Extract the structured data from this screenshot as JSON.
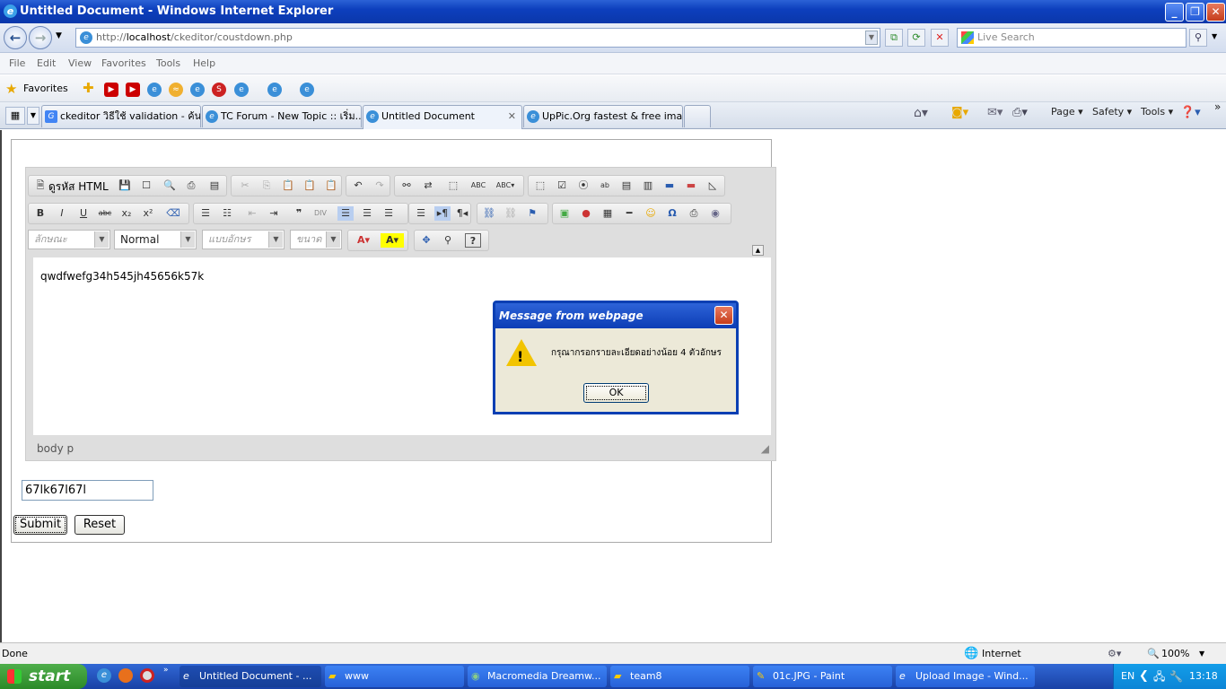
{
  "window": {
    "title": "Untitled Document - Windows Internet Explorer"
  },
  "address": {
    "url_prefix": "http://",
    "url_host": "localhost",
    "url_path": "/ckeditor/coustdown.php",
    "search_placeholder": "Live Search"
  },
  "menu": [
    "File",
    "Edit",
    "View",
    "Favorites",
    "Tools",
    "Help"
  ],
  "favorites": {
    "label": "Favorites"
  },
  "tabs": [
    {
      "label": "ckeditor วิธีใช้ validation - ค้น..."
    },
    {
      "label": "TC Forum - New Topic :: เริ่ม..."
    },
    {
      "label": "Untitled Document",
      "active": true
    },
    {
      "label": "UpPic.Org fastest & free ima..."
    }
  ],
  "commandbar": {
    "page": "Page",
    "safety": "Safety",
    "tools": "Tools"
  },
  "editor": {
    "source_label": "ดูรหัส HTML",
    "style_combo": "ลักษณะ",
    "format_combo": "Normal",
    "font_combo": "แบบอักษร",
    "size_combo": "ขนาด",
    "content": "qwdfwefg34h545jh45656k57k",
    "path": "body  p"
  },
  "form": {
    "text_value": "67lk67l67l",
    "submit_label": "Submit",
    "reset_label": "Reset"
  },
  "dialog": {
    "title": "Message from webpage",
    "message": "กรุณากรอกรายละเอียดอย่างน้อย 4 ตัวอักษร",
    "ok_label": "OK"
  },
  "status": {
    "left": "Done",
    "zone": "Internet",
    "zoom": "100%"
  },
  "taskbar": {
    "start": "start",
    "items": [
      {
        "label": "Untitled Document - ...",
        "active": true
      },
      {
        "label": "www"
      },
      {
        "label": "Macromedia Dreamw..."
      },
      {
        "label": "team8"
      },
      {
        "label": "01c.JPG - Paint"
      },
      {
        "label": "Upload Image - Wind..."
      }
    ],
    "lang": "EN",
    "clock": "13:18"
  },
  "colors": {
    "title_blue": "#0d3fbd",
    "dialog_bg": "#ece9d8",
    "warning_yellow": "#f2c400",
    "start_green": "#2b8a28"
  }
}
